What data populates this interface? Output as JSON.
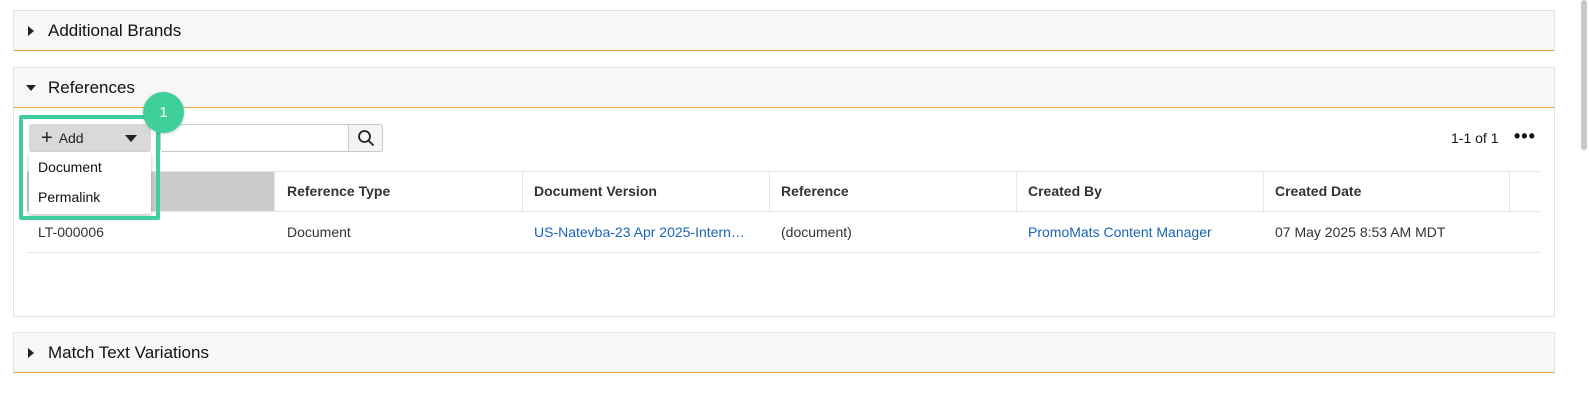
{
  "sections": {
    "additional_brands": {
      "title": "Additional Brands"
    },
    "references": {
      "title": "References"
    },
    "match_text_variations": {
      "title": "Match Text Variations"
    }
  },
  "toolbar": {
    "add_label": "Add",
    "add_menu": [
      "Document",
      "Permalink"
    ],
    "search_placeholder": "",
    "pager": "1-1 of 1",
    "more_label": "•••"
  },
  "annotation": {
    "step": "1",
    "color": "#3ecf9a"
  },
  "table": {
    "columns": [
      "",
      "Reference Type",
      "Document Version",
      "Reference",
      "Created By",
      "Created Date"
    ],
    "rows": [
      [
        "LT-000006",
        "Document",
        "US-Natevba-23 Apr 2025-Intern…",
        "(document)",
        "PromoMats Content Manager",
        "07 May 2025 8:53 AM MDT"
      ]
    ]
  },
  "colors": {
    "accent_orange": "#f0a04b",
    "link": "#1a64b4"
  }
}
